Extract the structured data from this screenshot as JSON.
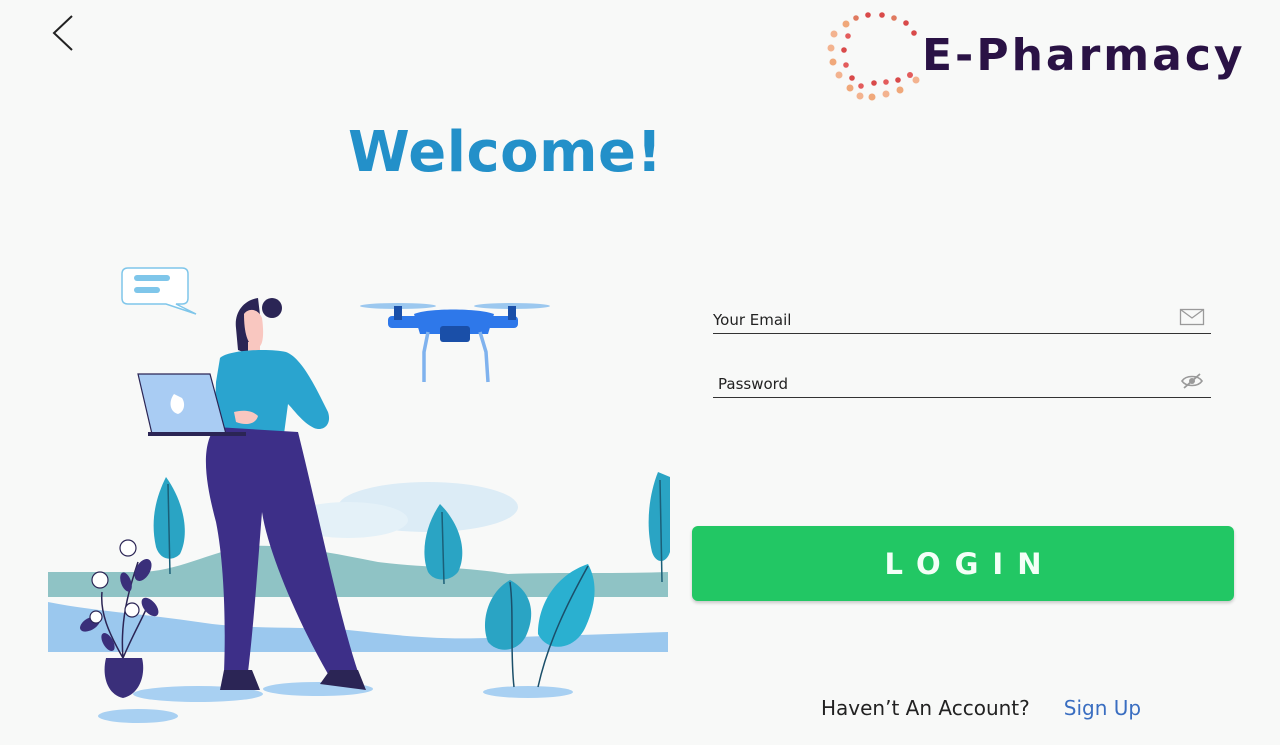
{
  "header": {
    "back_icon": "chevron-left-icon",
    "logo_text": "E-Pharmacy"
  },
  "welcome": {
    "title": "Welcome!"
  },
  "form": {
    "email": {
      "placeholder": "Your Email",
      "value": "",
      "icon": "mail-icon"
    },
    "password": {
      "placeholder": "Password",
      "value": "",
      "icon": "eye-off-icon"
    },
    "login_label": "LOGIN"
  },
  "signup": {
    "question": "Haven’t An Account?",
    "link": "Sign Up"
  },
  "colors": {
    "background": "#f8f9f8",
    "welcome": "#2390c9",
    "login_button": "#22c764",
    "link": "#3a6ec1",
    "logo_text": "#2a1245"
  }
}
